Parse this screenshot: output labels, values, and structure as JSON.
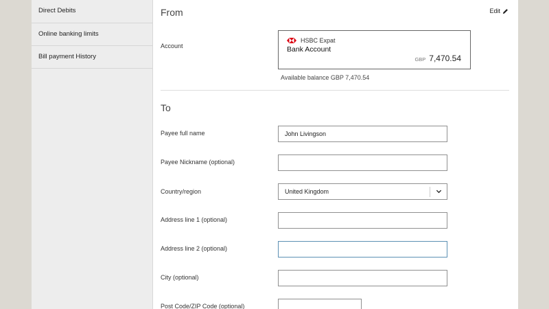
{
  "sidebar": {
    "items": [
      {
        "label": "Direct Debits"
      },
      {
        "label": "Online banking limits"
      },
      {
        "label": "Bill payment History"
      }
    ]
  },
  "from": {
    "title": "From",
    "edit_label": "Edit",
    "account_label": "Account",
    "account": {
      "bank": "HSBC Expat",
      "name": "Bank Account",
      "currency": "GBP",
      "balance": "7,470.54"
    },
    "available_balance": "Available balance GBP 7,470.54"
  },
  "to": {
    "title": "To",
    "fields": {
      "payee_full_name": {
        "label": "Payee full name",
        "value": "John Livingson"
      },
      "payee_nickname": {
        "label": "Payee Nickname (optional)",
        "value": ""
      },
      "country": {
        "label": "Country/region",
        "value": "United Kingdom"
      },
      "address1": {
        "label": "Address line 1 (optional)",
        "value": ""
      },
      "address2": {
        "label": "Address line 2 (optional)",
        "value": ""
      },
      "city": {
        "label": "City (optional)",
        "value": ""
      },
      "postcode": {
        "label": "Post Code/ZIP Code (optional)",
        "value": ""
      }
    }
  },
  "colors": {
    "brand_red": "#db0011",
    "focus_border": "#5b8fb3"
  },
  "icons": {
    "edit": "pencil-icon",
    "logo": "hsbc-hexagon-logo",
    "dropdown": "chevron-down-icon"
  }
}
